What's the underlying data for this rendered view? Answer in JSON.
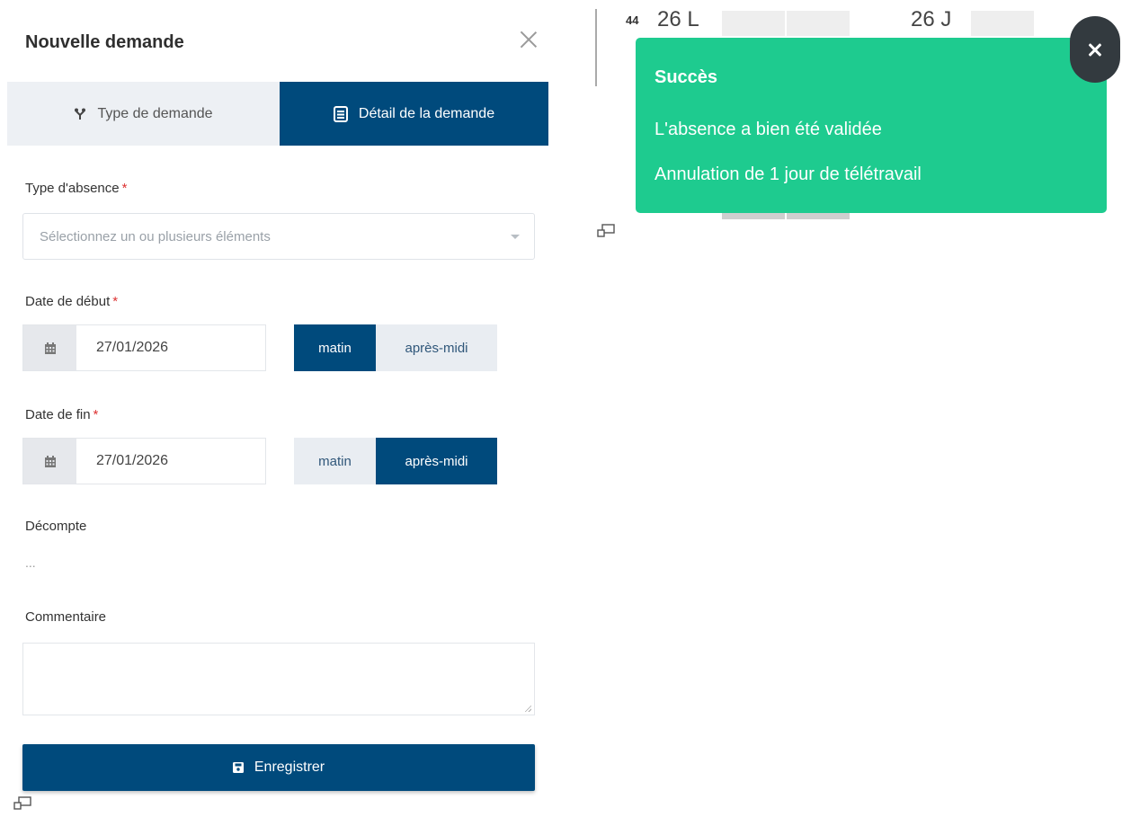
{
  "panel": {
    "title": "Nouvelle demande",
    "tabs": [
      {
        "label": "Type de demande",
        "icon": "branch-icon",
        "active": false
      },
      {
        "label": "Détail de la demande",
        "icon": "document-icon",
        "active": true
      }
    ]
  },
  "form": {
    "absence_type": {
      "label": "Type d'absence",
      "required_mark": "*",
      "placeholder": "Sélectionnez un ou plusieurs éléments"
    },
    "start_date": {
      "label": "Date de début",
      "required_mark": "*",
      "value": "27/01/2026",
      "options": [
        "matin",
        "après-midi"
      ],
      "selected": "matin"
    },
    "end_date": {
      "label": "Date de fin",
      "required_mark": "*",
      "value": "27/01/2026",
      "options": [
        "matin",
        "après-midi"
      ],
      "selected": "après-midi"
    },
    "decompte": {
      "label": "Décompte",
      "value": "..."
    },
    "comment": {
      "label": "Commentaire",
      "value": ""
    },
    "save_label": "Enregistrer"
  },
  "calendar": {
    "week_number": "44",
    "day_left": "26 L",
    "day_right": "26 J"
  },
  "toast": {
    "title": "Succès",
    "line1": "L'absence a bien été validée",
    "line2": "Annulation de 1 jour de télétravail",
    "color": "#1ecb8f"
  },
  "colors": {
    "primary": "#004a7c",
    "success": "#1ecb8f",
    "required": "#dd3333"
  }
}
